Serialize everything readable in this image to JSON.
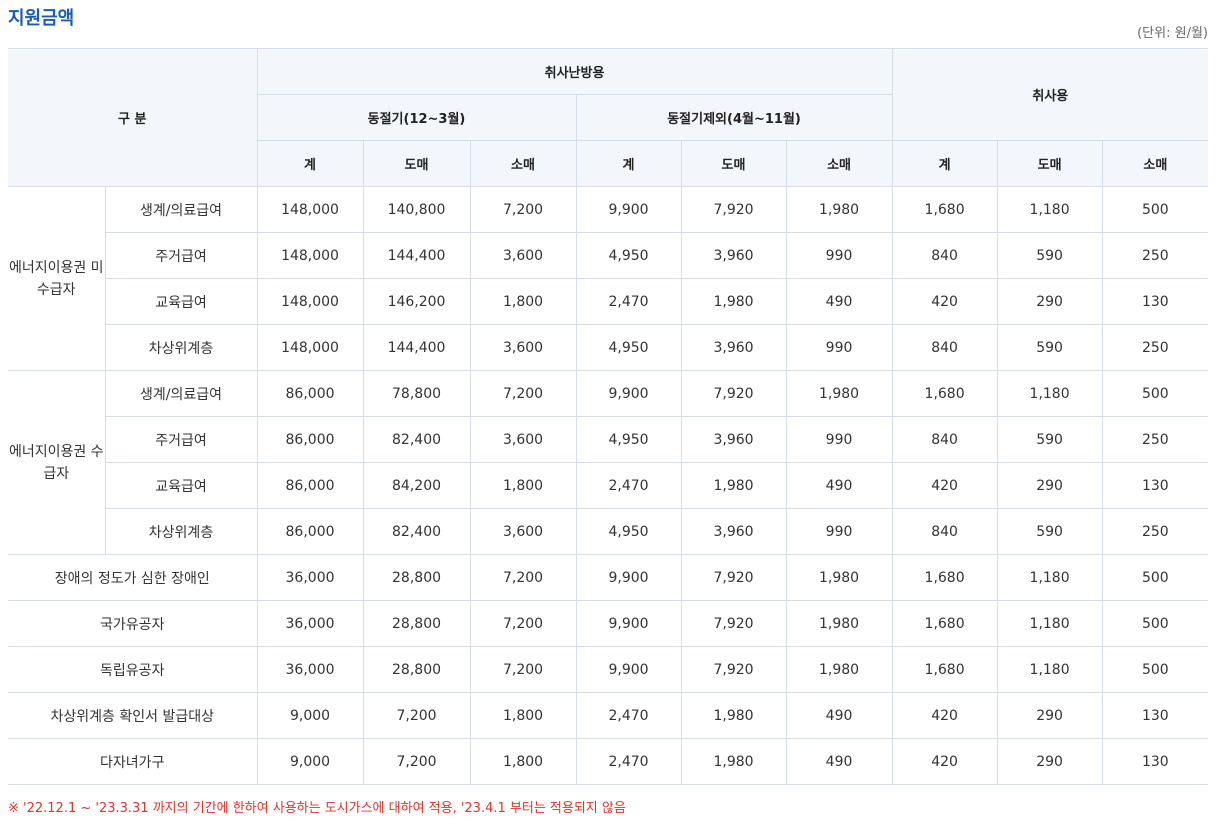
{
  "title": "지원금액",
  "unit": "(단위: 원/월)",
  "headers": {
    "category": "구 분",
    "cooking_heating": "취사난방용",
    "winter": "동절기(12~3월)",
    "non_winter": "동절기제외(4월~11월)",
    "cooking": "취사용",
    "sub": [
      "계",
      "도매",
      "소매",
      "계",
      "도매",
      "소매",
      "계",
      "도매",
      "소매"
    ]
  },
  "groups": [
    {
      "label": "에너지이용권 미수급자",
      "rows": [
        {
          "label": "생계/의료급여",
          "values": [
            "148,000",
            "140,800",
            "7,200",
            "9,900",
            "7,920",
            "1,980",
            "1,680",
            "1,180",
            "500"
          ]
        },
        {
          "label": "주거급여",
          "values": [
            "148,000",
            "144,400",
            "3,600",
            "4,950",
            "3,960",
            "990",
            "840",
            "590",
            "250"
          ]
        },
        {
          "label": "교육급여",
          "values": [
            "148,000",
            "146,200",
            "1,800",
            "2,470",
            "1,980",
            "490",
            "420",
            "290",
            "130"
          ]
        },
        {
          "label": "차상위계층",
          "values": [
            "148,000",
            "144,400",
            "3,600",
            "4,950",
            "3,960",
            "990",
            "840",
            "590",
            "250"
          ]
        }
      ]
    },
    {
      "label": "에너지이용권 수급자",
      "rows": [
        {
          "label": "생계/의료급여",
          "values": [
            "86,000",
            "78,800",
            "7,200",
            "9,900",
            "7,920",
            "1,980",
            "1,680",
            "1,180",
            "500"
          ]
        },
        {
          "label": "주거급여",
          "values": [
            "86,000",
            "82,400",
            "3,600",
            "4,950",
            "3,960",
            "990",
            "840",
            "590",
            "250"
          ]
        },
        {
          "label": "교육급여",
          "values": [
            "86,000",
            "84,200",
            "1,800",
            "2,470",
            "1,980",
            "490",
            "420",
            "290",
            "130"
          ]
        },
        {
          "label": "차상위계층",
          "values": [
            "86,000",
            "82,400",
            "3,600",
            "4,950",
            "3,960",
            "990",
            "840",
            "590",
            "250"
          ]
        }
      ]
    }
  ],
  "single_rows": [
    {
      "label": "장애의 정도가 심한 장애인",
      "values": [
        "36,000",
        "28,800",
        "7,200",
        "9,900",
        "7,920",
        "1,980",
        "1,680",
        "1,180",
        "500"
      ]
    },
    {
      "label": "국가유공자",
      "values": [
        "36,000",
        "28,800",
        "7,200",
        "9,900",
        "7,920",
        "1,980",
        "1,680",
        "1,180",
        "500"
      ]
    },
    {
      "label": "독립유공자",
      "values": [
        "36,000",
        "28,800",
        "7,200",
        "9,900",
        "7,920",
        "1,980",
        "1,680",
        "1,180",
        "500"
      ]
    },
    {
      "label": "차상위계층 확인서 발급대상",
      "values": [
        "9,000",
        "7,200",
        "1,800",
        "2,470",
        "1,980",
        "490",
        "420",
        "290",
        "130"
      ]
    },
    {
      "label": "다자녀가구",
      "values": [
        "9,000",
        "7,200",
        "1,800",
        "2,470",
        "1,980",
        "490",
        "420",
        "290",
        "130"
      ]
    }
  ],
  "note": "※ '22.12.1 ~ '23.3.31 까지의 기간에 한하여 사용하는 도시가스에 대하여 적용, '23.4.1 부터는 적용되지 않음"
}
